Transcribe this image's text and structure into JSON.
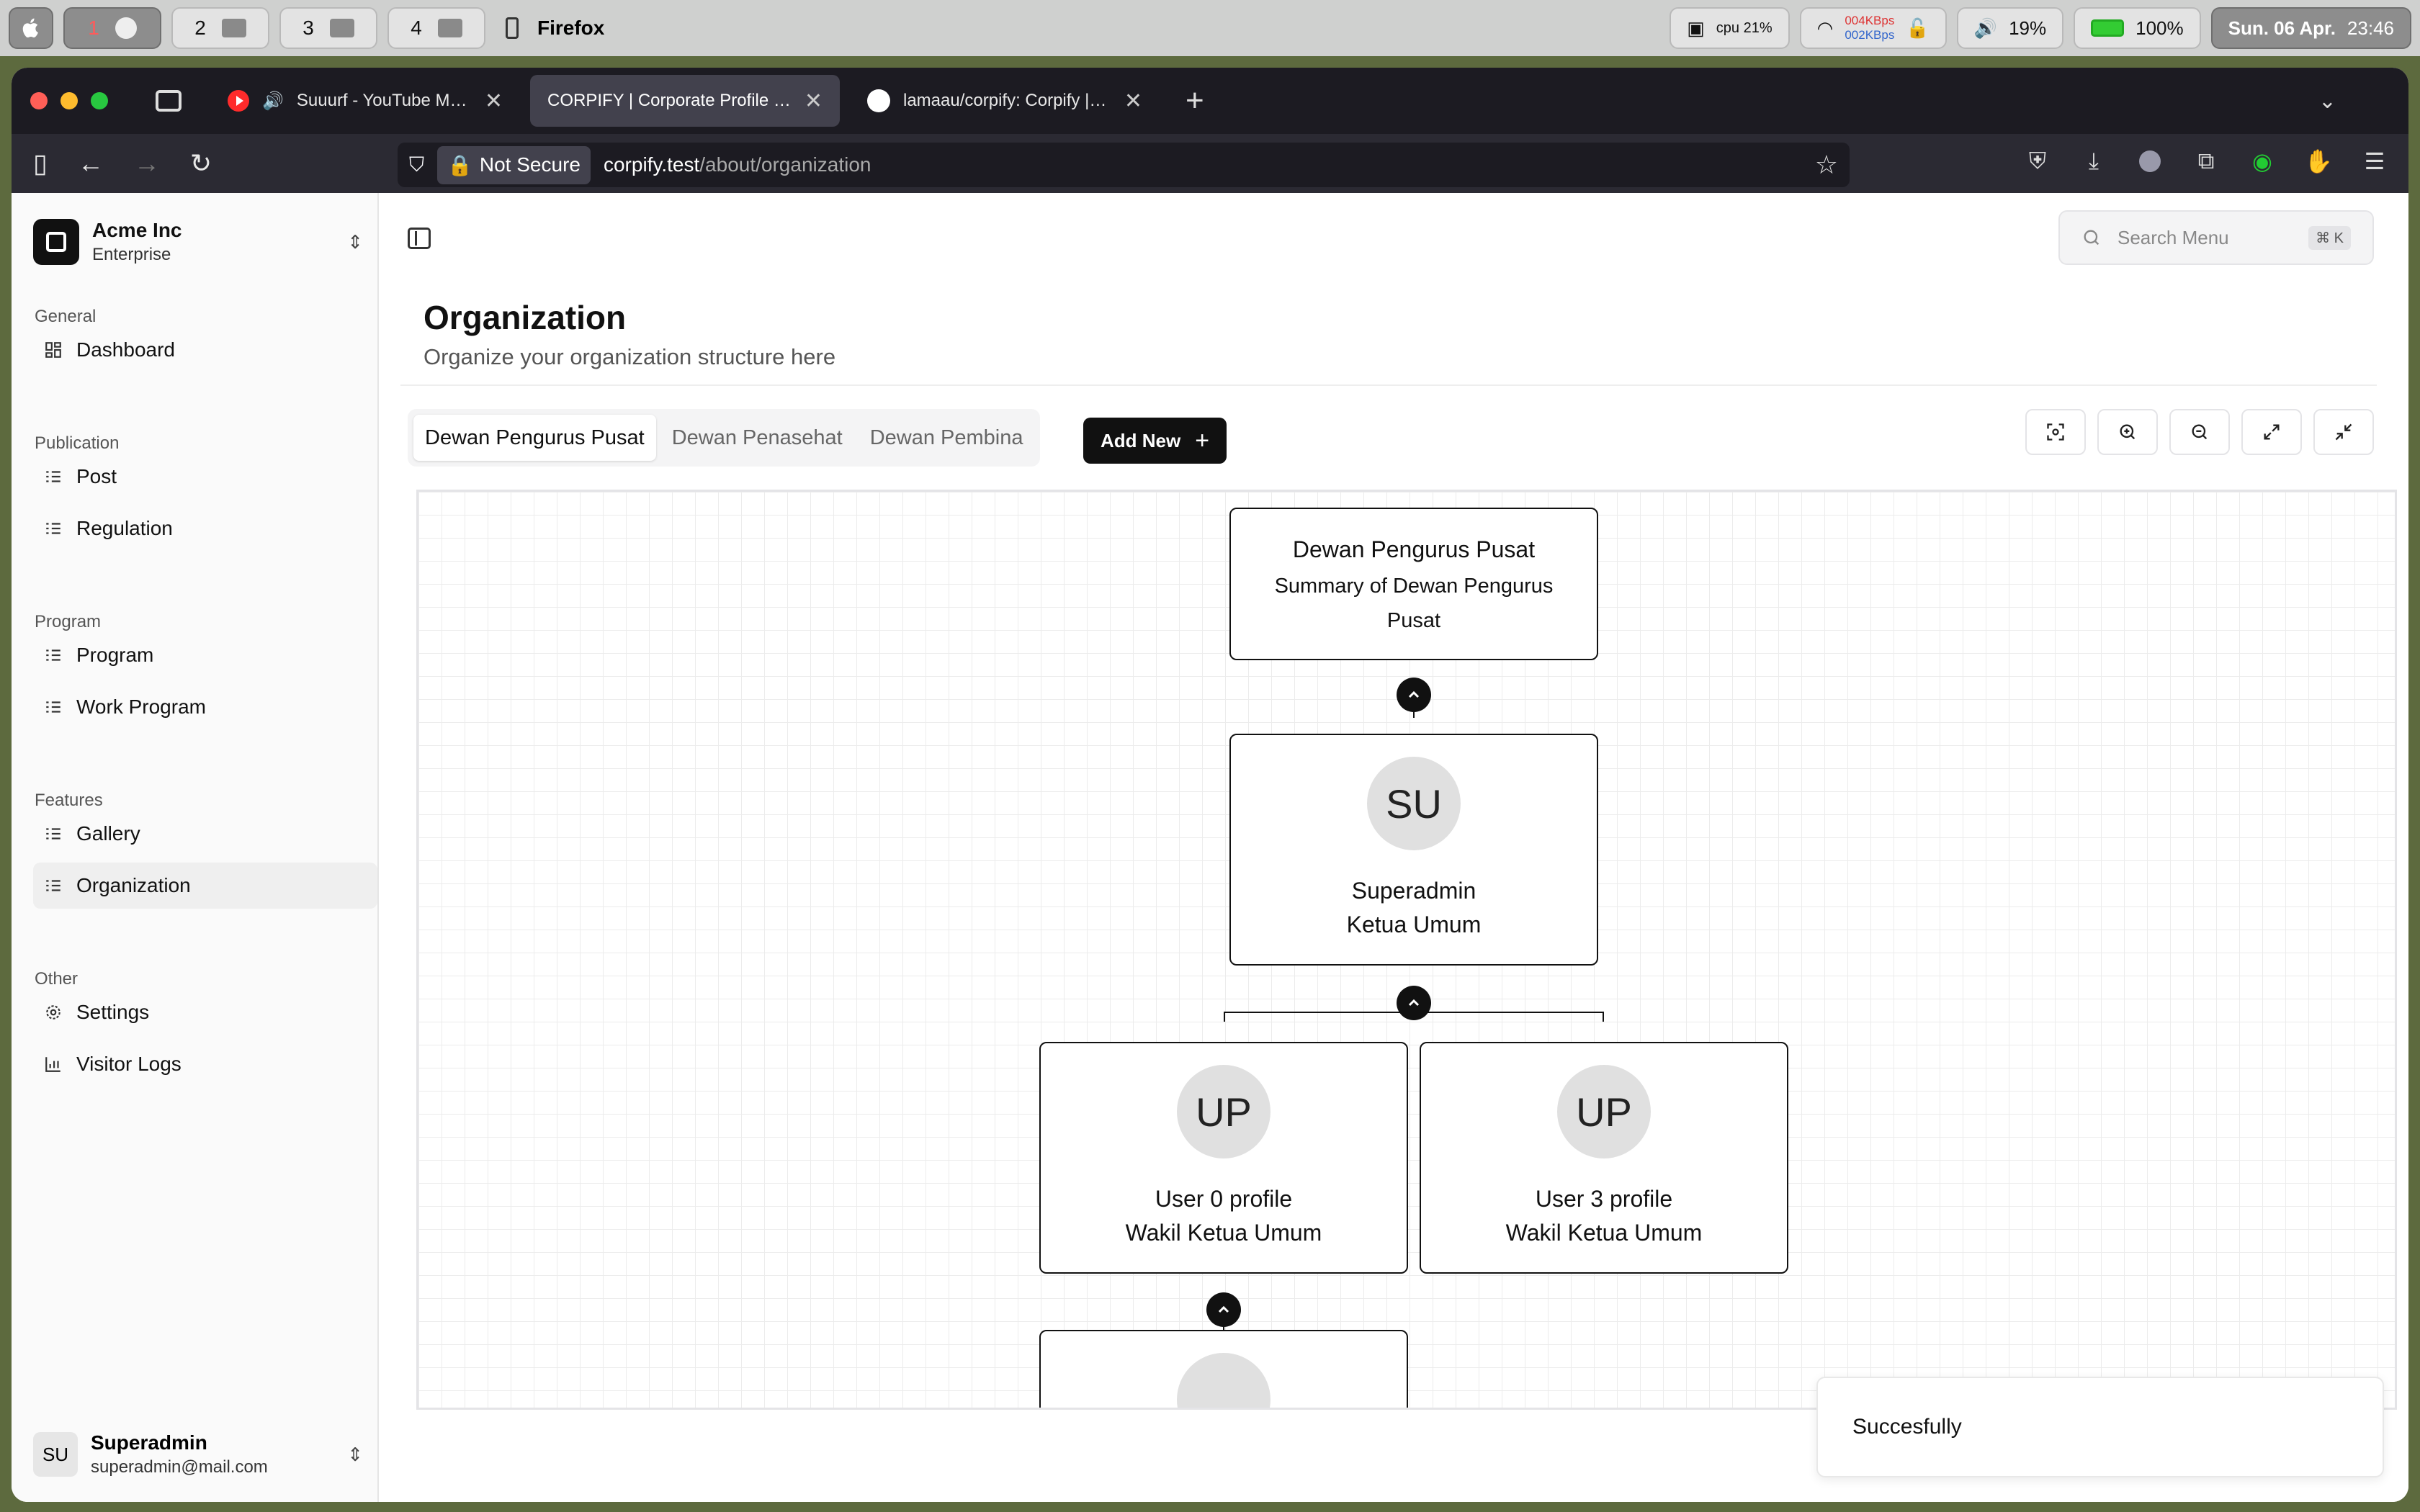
{
  "system_bar": {
    "workspaces": [
      "1",
      "2",
      "3",
      "4"
    ],
    "active_app": "Firefox",
    "cpu": "cpu 21%",
    "net_up": "004KBps",
    "net_down": "002KBps",
    "volume": "19%",
    "battery": "100%",
    "date": "Sun. 06 Apr.",
    "time": "23:46"
  },
  "browser": {
    "tabs": [
      {
        "label": "Suuurf - YouTube Music"
      },
      {
        "label": "CORPIFY | Corporate Profile Showcase"
      },
      {
        "label": "lamaau/corpify: Corpify | Corporate Profile"
      }
    ],
    "security_label": "Not Secure",
    "url_host": "corpify.test",
    "url_path": "/about/organization"
  },
  "sidebar": {
    "team_name": "Acme Inc",
    "team_plan": "Enterprise",
    "groups": [
      {
        "label": "General",
        "items": [
          {
            "label": "Dashboard",
            "icon": "layout-dashboard-icon"
          }
        ]
      },
      {
        "label": "Publication",
        "items": [
          {
            "label": "Post",
            "icon": "list-checks-icon"
          },
          {
            "label": "Regulation",
            "icon": "list-checks-icon"
          }
        ]
      },
      {
        "label": "Program",
        "items": [
          {
            "label": "Program",
            "icon": "list-checks-icon"
          },
          {
            "label": "Work Program",
            "icon": "list-checks-icon"
          }
        ]
      },
      {
        "label": "Features",
        "items": [
          {
            "label": "Gallery",
            "icon": "list-checks-icon"
          },
          {
            "label": "Organization",
            "icon": "list-checks-icon"
          }
        ]
      },
      {
        "label": "Other",
        "items": [
          {
            "label": "Settings",
            "icon": "gear-icon"
          },
          {
            "label": "Visitor Logs",
            "icon": "bar-chart-icon"
          }
        ]
      }
    ],
    "user": {
      "initials": "SU",
      "name": "Superadmin",
      "email": "superadmin@mail.com"
    }
  },
  "search": {
    "placeholder": "Search Menu",
    "shortcut": "⌘ K"
  },
  "page": {
    "title": "Organization",
    "subtitle": "Organize your organization structure here",
    "tabs": [
      "Dewan Pengurus Pusat",
      "Dewan Penasehat",
      "Dewan Pembina"
    ],
    "add_button": "Add New"
  },
  "org_chart": {
    "root": {
      "title": "Dewan Pengurus Pusat",
      "summary": "Summary of Dewan Pengurus Pusat"
    },
    "chair": {
      "initials": "SU",
      "name": "Superadmin",
      "role": "Ketua Umum"
    },
    "vice": [
      {
        "initials": "UP",
        "name": "User 0 profile",
        "role": "Wakil Ketua Umum"
      },
      {
        "initials": "UP",
        "name": "User 3 profile",
        "role": "Wakil Ketua Umum"
      }
    ]
  },
  "toast": {
    "message": "Succesfully"
  }
}
